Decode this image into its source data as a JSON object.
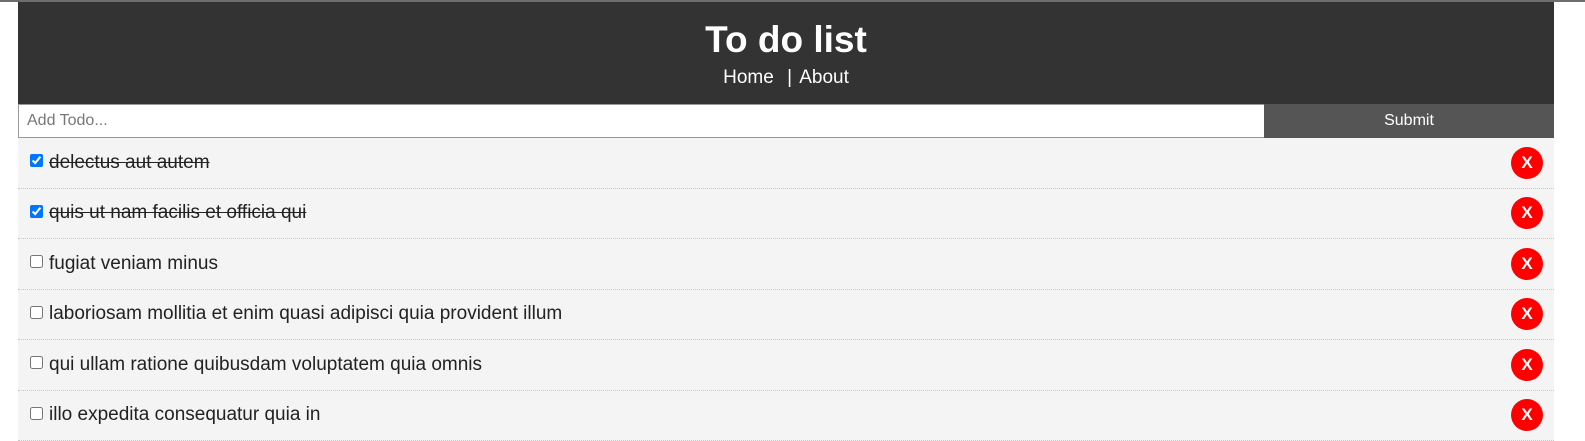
{
  "header": {
    "title": "To do list",
    "nav": {
      "home": "Home",
      "separator": "|",
      "about": "About"
    }
  },
  "add_form": {
    "placeholder": "Add Todo...",
    "value": "",
    "submit_label": "Submit"
  },
  "delete_label": "X",
  "todos": [
    {
      "title": "delectus aut autem",
      "completed": true
    },
    {
      "title": "quis ut nam facilis et officia qui",
      "completed": true
    },
    {
      "title": "fugiat veniam minus",
      "completed": false
    },
    {
      "title": "laboriosam mollitia et enim quasi adipisci quia provident illum",
      "completed": false
    },
    {
      "title": "qui ullam ratione quibusdam voluptatem quia omnis",
      "completed": false
    },
    {
      "title": "illo expedita consequatur quia in",
      "completed": false
    }
  ],
  "colors": {
    "header_bg": "#333333",
    "submit_bg": "#555555",
    "item_bg": "#f4f4f4",
    "delete_bg": "#ff0000"
  }
}
